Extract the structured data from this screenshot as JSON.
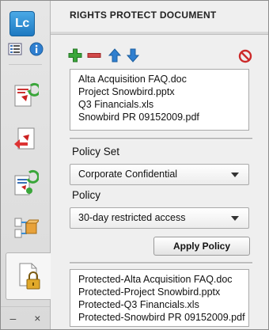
{
  "app": {
    "logo_text": "Lc"
  },
  "panel": {
    "title": "RIGHTS PROTECT DOCUMENT"
  },
  "toolbar": {
    "add": "add-icon",
    "remove": "remove-icon",
    "up": "move-up-icon",
    "down": "move-down-icon",
    "clear": "clear-icon"
  },
  "files": [
    "Alta Acquisition FAQ.doc",
    "Project Snowbird.pptx",
    "Q3 Financials.xls",
    "Snowbird PR 09152009.pdf"
  ],
  "policy_set": {
    "label": "Policy Set",
    "value": "Corporate Confidential"
  },
  "policy": {
    "label": "Policy",
    "value": "30-day restricted access"
  },
  "apply_button": "Apply Policy",
  "results": [
    "Protected-Alta Acquisition FAQ.doc",
    "Protected-Project Snowbird.pptx",
    "Protected-Q3 Financials.xls",
    "Protected-Snowbird PR 09152009.pdf"
  ],
  "rail_bottom": {
    "minimize": "–",
    "close": "×"
  },
  "colors": {
    "accent": "#1e79c1",
    "add": "#3aa63a",
    "remove": "#d24a4a",
    "arrows": "#2f7fd0",
    "clear": "#cc2a2a"
  }
}
